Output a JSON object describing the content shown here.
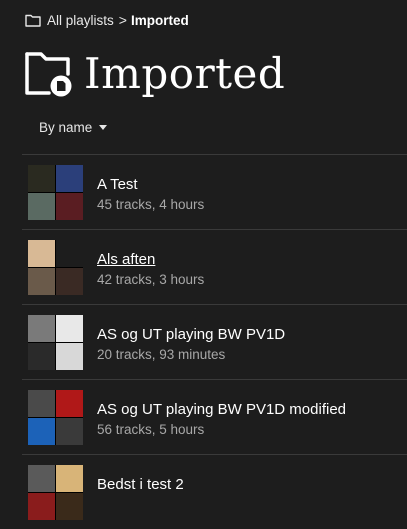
{
  "breadcrumb": {
    "parent_label": "All playlists",
    "separator": ">",
    "current_label": "Imported",
    "icon": "folder-icon"
  },
  "page": {
    "title": "Imported",
    "icon": "folder-import-icon"
  },
  "sort": {
    "label": "By name",
    "icon": "caret-down-icon"
  },
  "colors": {
    "background": "#1d1d1d",
    "text": "#ffffff",
    "muted": "#a8a8a8",
    "divider": "#3a3a3a"
  },
  "playlists": [
    {
      "name": "A Test",
      "meta": "45 tracks, 4 hours",
      "hovered": false,
      "covers": [
        "#2a2a20",
        "#2b3f7a",
        "#5a6a62",
        "#5a1d22"
      ]
    },
    {
      "name": "Als aften",
      "meta": "42 tracks, 3 hours",
      "hovered": true,
      "covers": [
        "#d8b995",
        "#1d1d1d",
        "#6a5a4a",
        "#3a2a24"
      ]
    },
    {
      "name": "AS og UT playing BW PV1D",
      "meta": "20 tracks, 93 minutes",
      "hovered": false,
      "covers": [
        "#7a7a7a",
        "#e8e8e8",
        "#2a2a2a",
        "#d8d8d8"
      ]
    },
    {
      "name": "AS og UT playing BW PV1D modified",
      "meta": "56 tracks, 5 hours",
      "hovered": false,
      "covers": [
        "#4a4a4a",
        "#b01818",
        "#1c62b8",
        "#3a3a3a"
      ]
    },
    {
      "name": "Bedst i test 2",
      "meta": "",
      "hovered": false,
      "covers": [
        "#5a5a5a",
        "#d8b478",
        "#8a1c1c",
        "#3a2a1a"
      ]
    }
  ]
}
